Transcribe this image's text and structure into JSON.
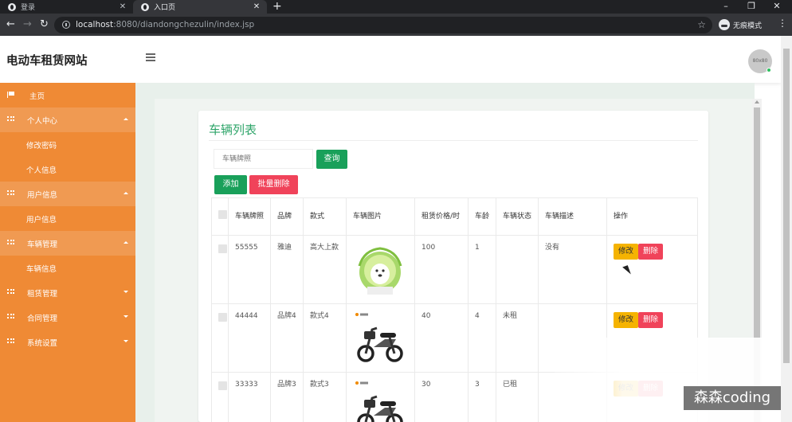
{
  "browser": {
    "tabs": [
      {
        "title": "登录",
        "active": false
      },
      {
        "title": "入口页",
        "active": true
      }
    ],
    "url_host": "localhost",
    "url_rest": ":8080/diandongchezulin/index.jsp",
    "incognito_label": "无痕模式"
  },
  "header": {
    "site_title": "电动车租赁网站",
    "avatar_text": "80x80"
  },
  "sidebar": {
    "items": [
      {
        "label": "主页",
        "icon": "flag-icon",
        "type": "home"
      },
      {
        "label": "个人中心",
        "icon": "grid-icon",
        "type": "parent",
        "caret": "up"
      },
      {
        "label": "修改密码",
        "type": "child"
      },
      {
        "label": "个人信息",
        "type": "child"
      },
      {
        "label": "用户信息",
        "icon": "grid-icon",
        "type": "parent",
        "caret": "up"
      },
      {
        "label": "用户信息",
        "type": "child"
      },
      {
        "label": "车辆管理",
        "icon": "grid-icon",
        "type": "parent",
        "caret": "up"
      },
      {
        "label": "车辆信息",
        "type": "child"
      },
      {
        "label": "租赁管理",
        "icon": "grid-icon",
        "type": "parent",
        "caret": "down"
      },
      {
        "label": "合同管理",
        "icon": "grid-icon",
        "type": "parent",
        "caret": "down"
      },
      {
        "label": "系统设置",
        "icon": "grid-icon",
        "type": "parent",
        "caret": "down"
      }
    ]
  },
  "main": {
    "title": "车辆列表",
    "search_placeholder": "车辆牌照",
    "query_label": "查询",
    "add_label": "添加",
    "batch_delete_label": "批量删除",
    "columns": [
      "车辆牌照",
      "品牌",
      "款式",
      "车辆图片",
      "租赁价格/时",
      "车龄",
      "车辆状态",
      "车辆描述",
      "操作"
    ],
    "rows": [
      {
        "plate": "55555",
        "brand": "雅迪",
        "style": "高大上款",
        "image": "cabbage-dog-image",
        "price": "100",
        "age": "1",
        "status": "",
        "desc": "没有"
      },
      {
        "plate": "44444",
        "brand": "品牌4",
        "style": "款式4",
        "image": "e-scooter-image",
        "price": "40",
        "age": "4",
        "status": "未租",
        "desc": ""
      },
      {
        "plate": "33333",
        "brand": "品牌3",
        "style": "款式3",
        "image": "e-scooter-image",
        "price": "30",
        "age": "3",
        "status": "已租",
        "desc": ""
      }
    ],
    "edit_label": "修改",
    "delete_label": "删除"
  },
  "watermark": "森森coding",
  "colors": {
    "sidebar": "#ef8a35",
    "accent_green": "#19a05a",
    "danger": "#f0435a",
    "warning": "#f5b301",
    "title_green": "#2fa56a"
  }
}
